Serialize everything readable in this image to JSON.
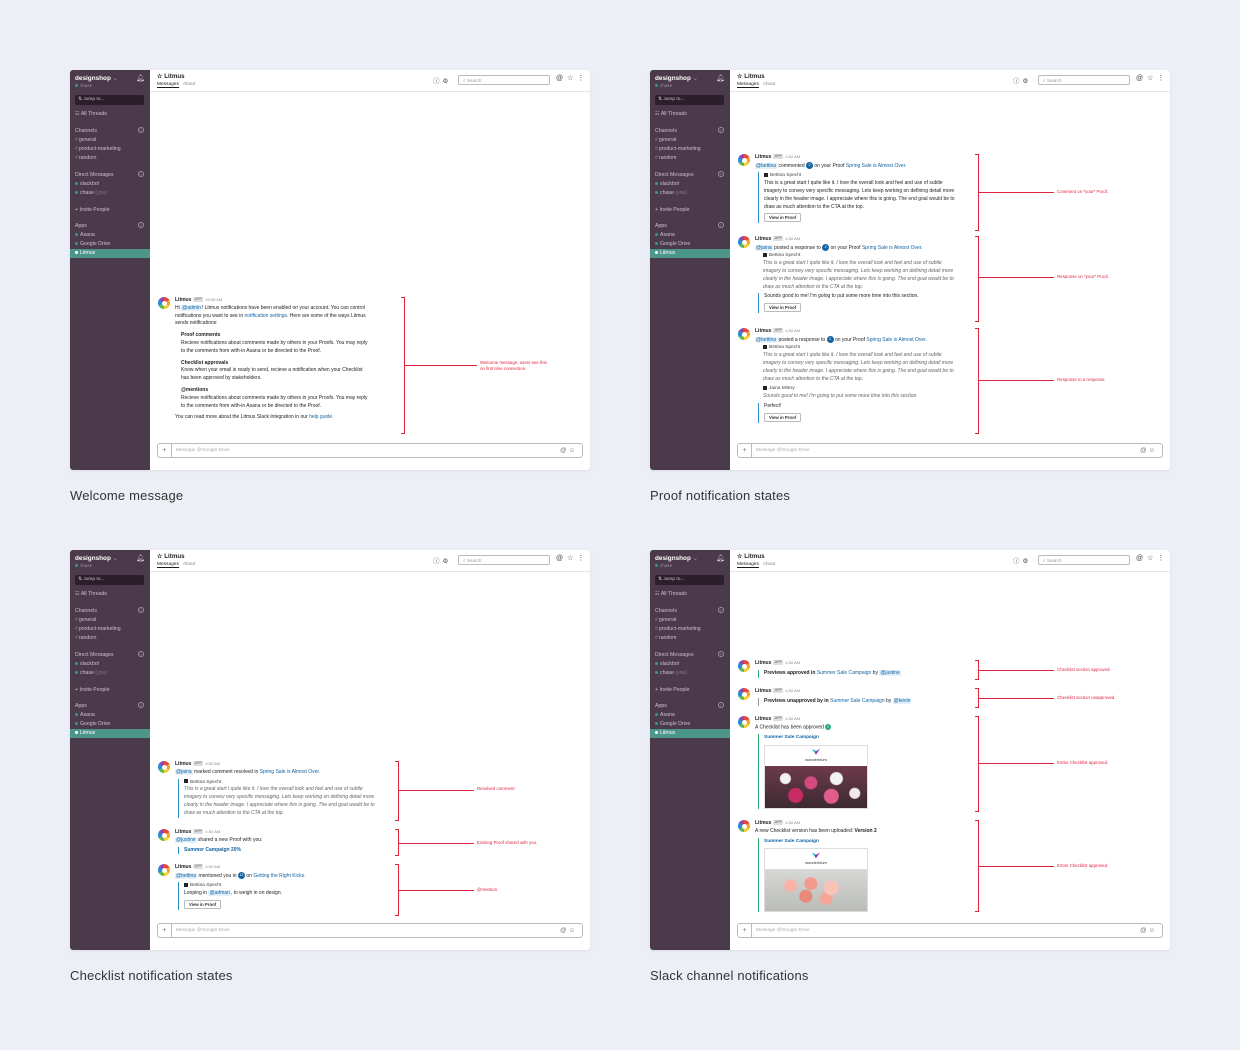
{
  "workspace": {
    "name": "designshop",
    "user": "chase"
  },
  "sidebar": {
    "jump_to": "Jump to...",
    "all_threads": "All Threads",
    "channels_head": "Channels",
    "channels": [
      "general",
      "product-marketing",
      "random"
    ],
    "dm_head": "Direct Messages",
    "dms": [
      {
        "name": "slackbot",
        "suffix": ""
      },
      {
        "name": "chase",
        "suffix": "(you)"
      }
    ],
    "invite": "+ Invite People",
    "apps_head": "Apps",
    "apps": [
      "Asana",
      "Google Drive",
      "Litmus"
    ]
  },
  "header": {
    "channel": "☆ Litmus",
    "tab_messages": "Messages",
    "tab_about": "About",
    "search_placeholder": "Search"
  },
  "compose_placeholder": "Message @Google Drive",
  "colors": {
    "sidebar": "#4a3a4a",
    "active": "#4c9689",
    "link": "#1264a3",
    "annotation": "#e0243b"
  },
  "panels": {
    "welcome": {
      "caption": "Welcome message",
      "msg": {
        "name": "Litmus",
        "app": "APP",
        "time": "10:08 AM",
        "hi": "Hi",
        "admin": "@admin",
        "line1": "! Litmus notifications have been enabled on your account. You can control notifications you want to see in",
        "settings_link": "notification settings",
        "line2": ". Here are some of the ways Litmus sends notifications:",
        "sec1_title": "Proof comments",
        "sec1_text": "Recieve notifications about comments made by others in your Proofs. You may reply to the comments from with-in Asana or be directed to the Proof.",
        "sec2_title": "Checklist approvals",
        "sec2_text": "Know when your email is ready to send, recieve a notification when your Checklist has been approved by stakeholders.",
        "sec3_title": "@mentions",
        "sec3_text": "Recieve notifications about comments made by others in your Proofs. You may reply to the comments from with-in Asana or be directed to the Proof.",
        "footer": "You can read more about the Litmus Slack integration in our",
        "help_link": "help guide",
        "footer_end": "."
      },
      "annotation": "Welcome message, users see this on first time connection."
    },
    "proof": {
      "caption": "Proof notification states",
      "m1": {
        "name": "Litmus",
        "app": "APP",
        "time": "4:52 AM",
        "user": "@bettina",
        "verb": "commented",
        "badge": "2",
        "mid": "on your Proof",
        "link": "Spring Sale is Almost Over.",
        "author": "Bettina Specht",
        "text": "This is a great start I quite like it. I love the overall look and feel and use of subtle imagery to convey very specific messaging. Lets keep working on defining detail more clearly in the header image. I appreciate where this is going. The end goal would be to draw as much attention to the CTA at the top.",
        "button": "View in Proof"
      },
      "m2": {
        "name": "Litmus",
        "app": "APP",
        "time": "4:52 AM",
        "user": "@jaina",
        "verb": "posted a response to",
        "badge": "2",
        "mid": "on your Proof",
        "link": "Spring Sale is Almost Over.",
        "author": "Bettina Specht",
        "quote": "This is a great start I quite like it. I love the overall look and feel and use of subtle imagery to convey very specific messaging. Lets keep working on defining detail more clearly in the header image. I appreciate where this is going. The end goal would be to draw as much attention to the CTA at the top.",
        "reply": "Sounds good to me! I'm golog to put some more time into this section.",
        "button": "View in Proof"
      },
      "m3": {
        "name": "Litmus",
        "app": "APP",
        "time": "4:52 AM",
        "user": "@bettina",
        "verb": "posted a response to",
        "badge": "2",
        "mid": "on your Proof",
        "link": "Spring Sale is Almost Over.",
        "author": "Bettina Specht",
        "quote": "This is a great start I quite like it. I love the overall look and feel and use of subtle imagery to convey very specific messaging. Lets keep working on defining detail more clearly in the header image. I appreciate where this is going. The end goal would be to draw as much attention to the CTA at the top.",
        "author2": "Jaina Mistry",
        "quote2": "Sounds good to me! I'm going to put some more time into this section.",
        "reply": "Perfect!",
        "button": "View in Proof"
      },
      "annotations": [
        "Comment on *your* Proof.",
        "Response on *your* Proof.",
        "Response to a response"
      ]
    },
    "checklist": {
      "caption": "Checklist notification states",
      "m1": {
        "name": "Litmus",
        "app": "APP",
        "time": "4:52 AM",
        "user": "@jaina",
        "verb": "marked comment resolved in",
        "link": "Spring Sale is Almost Over.",
        "author": "Bettina Specht",
        "quote": "This is a great start I quite like it. I love the overall look and feel and use of subtle imagery to convey very specific messaging. Lets keep working on defining detail more clearly in the header image. I appreciate where this is going. The end goal would be to draw as much attention to the CTA at the top."
      },
      "m2": {
        "name": "Litmus",
        "app": "APP",
        "time": "4:52 AM",
        "user": "@justine",
        "verb": "shared a new Proof with you:",
        "proof": "Summer Campaign 20%"
      },
      "m3": {
        "name": "Litmus",
        "app": "APP",
        "time": "4:52 AM",
        "user": "@bettina",
        "verb": "mentioned you in",
        "badge": "12",
        "on": "on",
        "link": "Getting the Right Kicks.",
        "author": "Bettina Specht",
        "looping": "Looping in",
        "admin": "@adman",
        "rest": ", to weigh in on design.",
        "button": "View in Proof"
      },
      "annotations": [
        "Resolved comment",
        "Existing Proof shared with you.",
        "@mention"
      ]
    },
    "slack": {
      "caption": "Slack channel notifications",
      "m1": {
        "name": "Litmus",
        "app": "APP",
        "time": "4:52 AM",
        "pre": "Previews approved in",
        "link": "Summer Sale Campaign",
        "by": "by",
        "user": "@justine"
      },
      "m2": {
        "name": "Litmus",
        "app": "APP",
        "time": "4:52 AM",
        "pre": "Previews unapproved by in",
        "link": "Summer Sale Campaign",
        "by": "by",
        "user": "@kevin"
      },
      "m3": {
        "name": "Litmus",
        "app": "APP",
        "time": "4:52 AM",
        "text": "A Checklist has been approved",
        "title": "Summer Sale Campaign",
        "brand": "wonderblum"
      },
      "m4": {
        "name": "Litmus",
        "app": "APP",
        "time": "4:52 AM",
        "text": "A new Checklist version has been uploaded:",
        "version": "Version 2",
        "title": "Summer Sale Campaign",
        "brand": "wonderblum"
      },
      "annotations": [
        "Checklist section approved.",
        "Checklist section unapproved.",
        "Entire Checklist approved.",
        "Entire Checklist approved."
      ]
    }
  }
}
